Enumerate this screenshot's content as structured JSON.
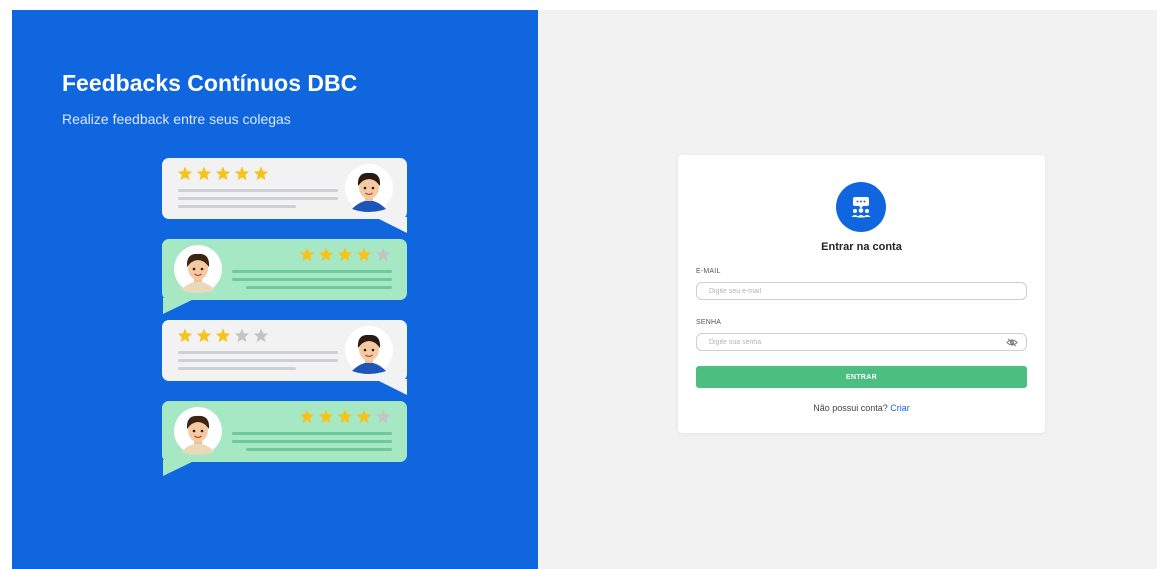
{
  "hero": {
    "title": "Feedbacks Contínuos DBC",
    "subtitle": "Realize feedback entre seus colegas"
  },
  "login": {
    "heading": "Entrar na conta",
    "email_label": "E-MAIL",
    "email_placeholder": "Digite seu e-mail",
    "email_value": "",
    "password_label": "SENHA",
    "password_placeholder": "Digite sua senha",
    "password_value": "",
    "submit_label": "ENTRAR",
    "signup_prompt": "Não possui conta?",
    "signup_link": "Criar"
  },
  "reviews": [
    {
      "rating": 5,
      "max": 5,
      "bubble_color": "#f2f2f2"
    },
    {
      "rating": 4,
      "max": 5,
      "bubble_color": "#a6e7c4"
    },
    {
      "rating": 3,
      "max": 5,
      "bubble_color": "#f2f2f2"
    },
    {
      "rating": 4,
      "max": 5,
      "bubble_color": "#a6e7c4"
    }
  ],
  "icons": {
    "logo": "feedback-team-icon",
    "password_toggle": "eye-off-icon"
  },
  "colors": {
    "brand_blue": "#1066de",
    "submit_green": "#4cbe80",
    "star_gold": "#f7c21b",
    "page_gray": "#f2f2f2"
  }
}
